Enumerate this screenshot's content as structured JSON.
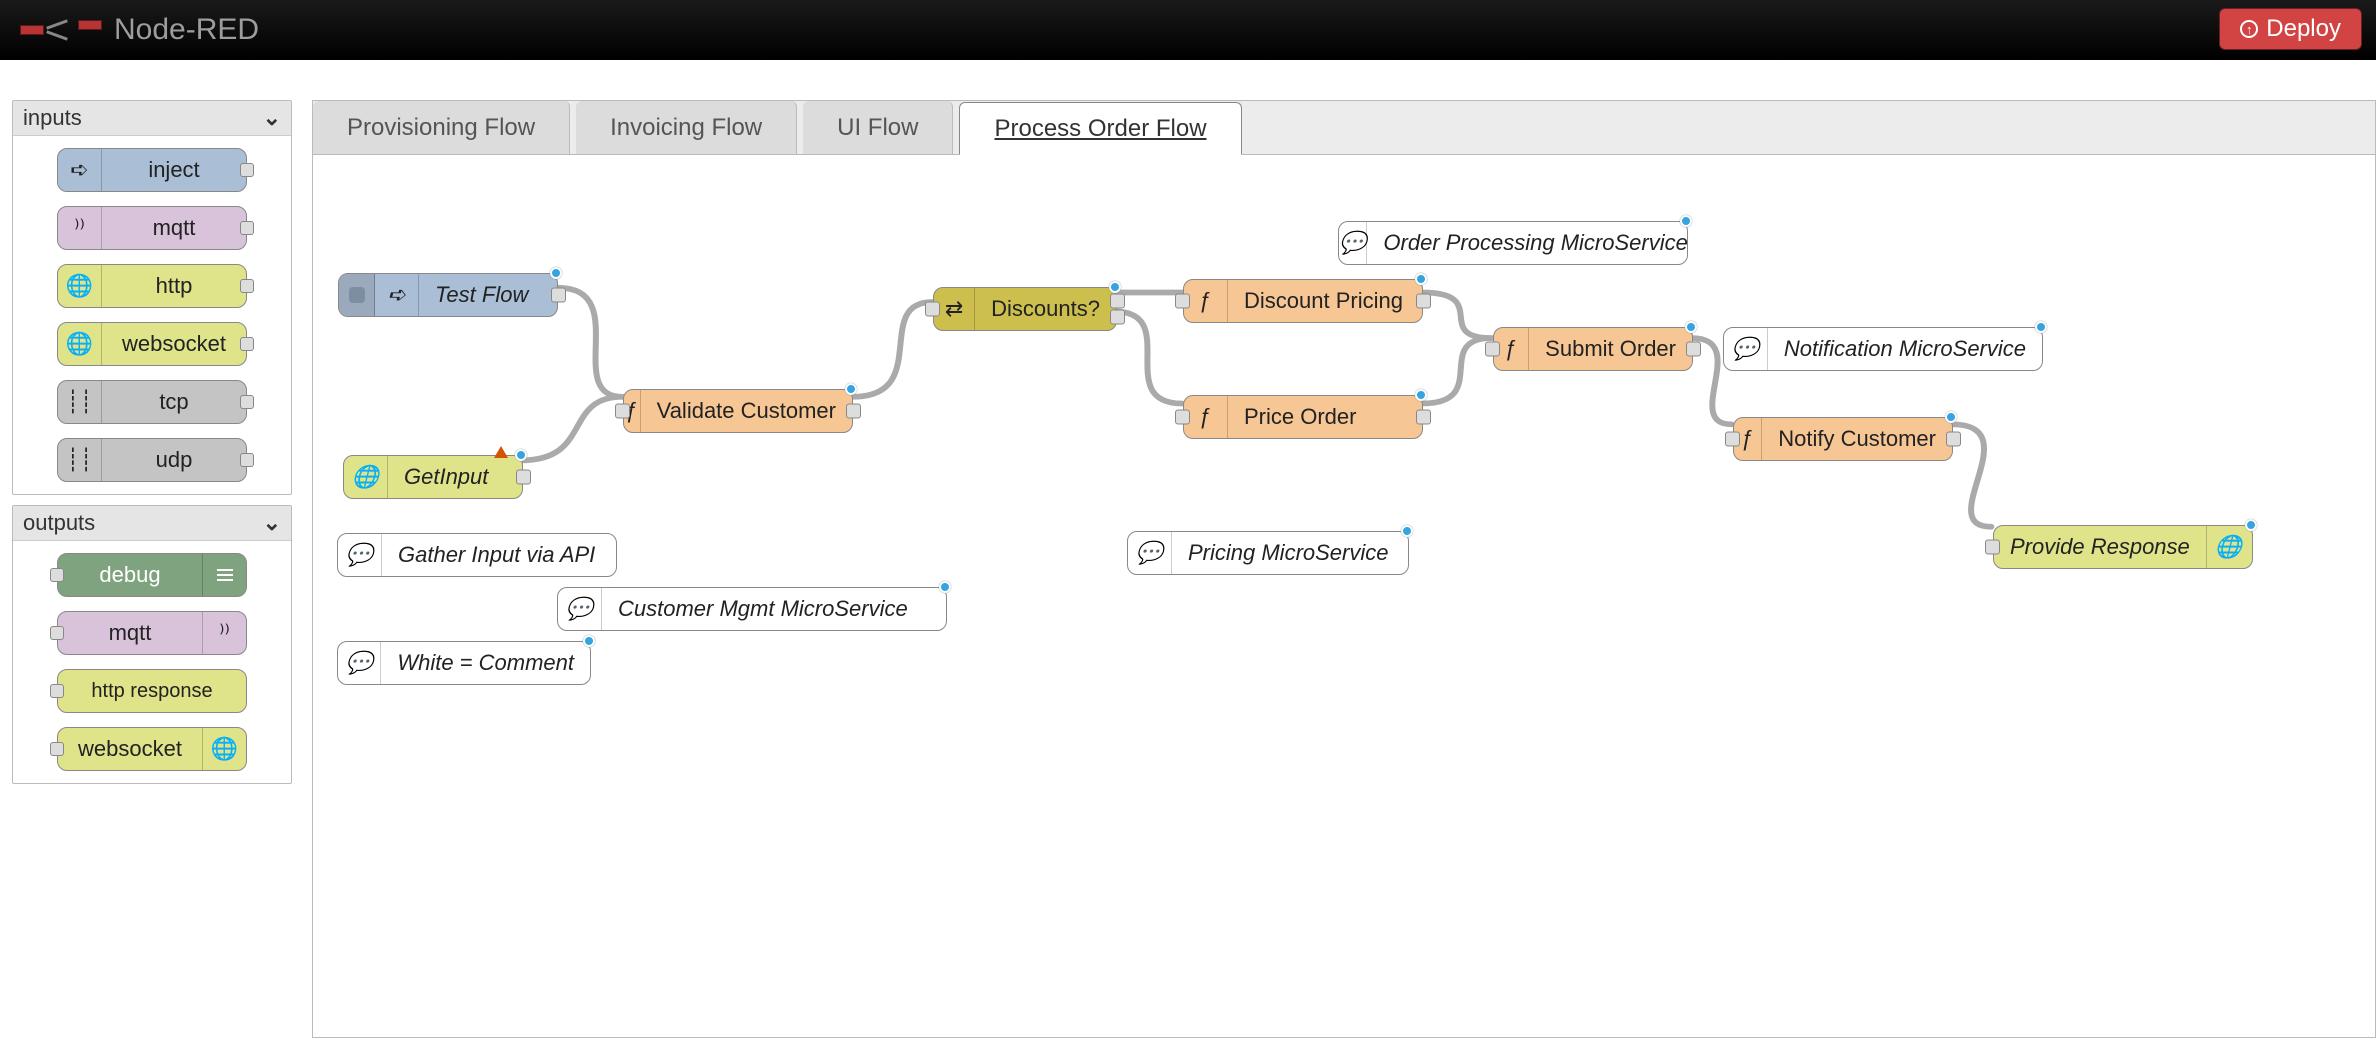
{
  "app": {
    "title": "Node-RED",
    "deploy": "Deploy"
  },
  "palette": {
    "sections": [
      {
        "title": "inputs",
        "items": [
          {
            "label": "inject",
            "color": "c-blue",
            "icon": "arrow-right-icon",
            "port": "out"
          },
          {
            "label": "mqtt",
            "color": "c-purple",
            "icon": "waves-icon",
            "port": "out"
          },
          {
            "label": "http",
            "color": "c-lime",
            "icon": "globe-icon",
            "port": "out"
          },
          {
            "label": "websocket",
            "color": "c-lime",
            "icon": "globe-icon",
            "port": "out"
          },
          {
            "label": "tcp",
            "color": "c-grey",
            "icon": "stream-icon",
            "port": "out"
          },
          {
            "label": "udp",
            "color": "c-grey",
            "icon": "stream-icon",
            "port": "out"
          }
        ]
      },
      {
        "title": "outputs",
        "items": [
          {
            "label": "debug",
            "color": "c-green",
            "icon": "burger-icon",
            "port": "in",
            "right": true
          },
          {
            "label": "mqtt",
            "color": "c-purple",
            "icon": "waves-icon",
            "port": "in",
            "right": true
          },
          {
            "label": "http response",
            "color": "c-lime",
            "icon": "none",
            "port": "in"
          },
          {
            "label": "websocket",
            "color": "c-lime",
            "icon": "globe-icon",
            "port": "in",
            "right": true
          }
        ]
      }
    ]
  },
  "tabs": [
    {
      "label": "Provisioning Flow",
      "active": false
    },
    {
      "label": "Invoicing Flow",
      "active": false
    },
    {
      "label": "UI Flow",
      "active": false
    },
    {
      "label": "Process Order Flow",
      "active": true
    }
  ],
  "nodes": {
    "topComment": "Order Processing MicroService",
    "testFlow": "Test Flow",
    "getInput": "GetInput",
    "gatherInput": "Gather Input via API",
    "validate": "Validate Customer",
    "custMgmt": "Customer Mgmt MicroService",
    "whiteComment": "White = Comment",
    "discounts": "Discounts?",
    "discountPricing": "Discount Pricing",
    "priceOrder": "Price Order",
    "pricingMicro": "Pricing MicroService",
    "submitOrder": "Submit Order",
    "notifMicro": "Notification MicroService",
    "notifyCustomer": "Notify Customer",
    "provideResponse": "Provide Response"
  },
  "colors": {
    "headerBg": "#000000",
    "deploy": "#d24444",
    "orange": "#f6c795",
    "olive": "#cdbf4e",
    "lime": "#dfe38a",
    "blue": "#aabfd6",
    "statusDot": "#35a4e0"
  }
}
